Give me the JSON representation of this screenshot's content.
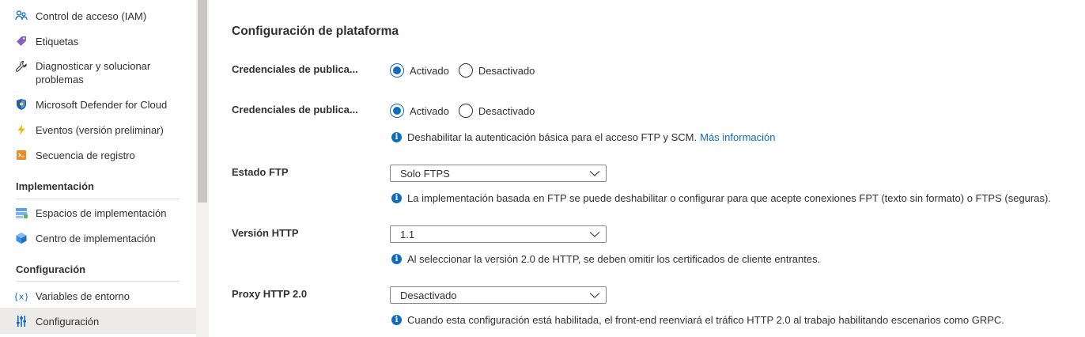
{
  "sidebar": {
    "items": [
      {
        "label": "Control de acceso (IAM)",
        "icon": "people-access-icon"
      },
      {
        "label": "Etiquetas",
        "icon": "tag-icon"
      },
      {
        "label": "Diagnosticar y solucionar problemas",
        "icon": "wrench-icon"
      },
      {
        "label": "Microsoft Defender for Cloud",
        "icon": "shield-icon"
      },
      {
        "label": "Eventos (versión preliminar)",
        "icon": "lightning-icon"
      },
      {
        "label": "Secuencia de registro",
        "icon": "log-stream-icon"
      }
    ],
    "sections": [
      {
        "title": "Implementación",
        "items": [
          {
            "label": "Espacios de implementación",
            "icon": "deployment-slots-icon"
          },
          {
            "label": "Centro de implementación",
            "icon": "cube-icon"
          }
        ]
      },
      {
        "title": "Configuración",
        "items": [
          {
            "label": "Variables de entorno",
            "icon": "variable-icon"
          },
          {
            "label": "Configuración",
            "icon": "sliders-icon",
            "selected": true
          }
        ]
      }
    ]
  },
  "main": {
    "title": "Configuración de plataforma",
    "rows": [
      {
        "label": "Credenciales de publica...",
        "options": [
          "Activado",
          "Desactivado"
        ],
        "selected": "Activado"
      },
      {
        "label": "Credenciales de publica...",
        "options": [
          "Activado",
          "Desactivado"
        ],
        "selected": "Activado",
        "info": "Deshabilitar la autenticación básica para el acceso FTP y SCM.",
        "link": "Más información"
      },
      {
        "label": "Estado FTP",
        "value": "Solo FTPS",
        "info": "La implementación basada en FTP se puede deshabilitar o configurar para que acepte conexiones FPT (texto sin formato) o FTPS (seguras)."
      },
      {
        "label": "Versión HTTP",
        "value": "1.1",
        "info": "Al seleccionar la versión 2.0 de HTTP, se deben omitir los certificados de cliente entrantes."
      },
      {
        "label": "Proxy HTTP 2.0",
        "value": "Desactivado",
        "info": "Cuando esta configuración está habilitada, el front-end reenviará el tráfico HTTP 2.0 al trabajo habilitando escenarios como GRPC."
      }
    ]
  },
  "colors": {
    "accent": "#0f6cbd",
    "selected_bg": "#edebe9",
    "text": "#323130"
  }
}
